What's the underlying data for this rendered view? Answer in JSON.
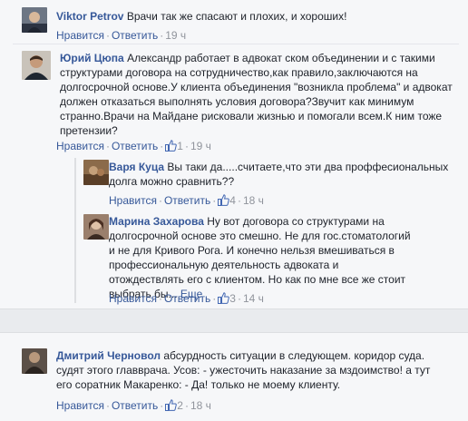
{
  "comments": [
    {
      "author": "Viktor Petrov",
      "text": "Врачи так же спасают и плохих, и хороших!",
      "like": "Нравится",
      "reply": "Ответить",
      "time": "19 ч"
    },
    {
      "author": "Юрий Цюпа",
      "text": "Александр работает в адвокат ском объединении и с такими структурами договора на сотрудничество,как правило,заключаются на долгосрочной основе.У клиента объединения \"возникла проблема\" и адвокат должен отказаться выполнять условия договора?Звучит как минимум странно.Врачи на Майдане рисковали жизнью и помогали всем.К ним тоже претензии?",
      "like": "Нравится",
      "reply": "Ответить",
      "likes": "1",
      "time": "19 ч"
    },
    {
      "author": "Варя Куца",
      "text": "Вы таки да.....считаете,что эти два проффесиональных долга можно сравнить??",
      "like": "Нравится",
      "reply": "Ответить",
      "likes": "4",
      "time": "18 ч"
    },
    {
      "author": "Марина Захарова",
      "text": "Ну вот договора со структурами на долгосрочной основе это смешно. Не для гос.стоматологий и не для Кривого Рога. И конечно нельзя вмешиваться в профессиональную деятельность адвоката и отождествлять его с клиентом. Но как по мне все же стоит выбрать бы...",
      "more": "Еще",
      "like": "Нравится",
      "reply": "Ответить",
      "likes": "3",
      "time": "14 ч"
    },
    {
      "author": "Дмитрий Черновол",
      "text": "абсурдность ситуации в следующем. коридор суда. судят этого главврача. Усов: - ужесточить наказание за мздоимство! а тут его соратник Макаренко: - Да! только не моему клиенту.",
      "like": "Нравится",
      "reply": "Ответить",
      "likes": "2",
      "time": "18 ч"
    }
  ],
  "colors": {
    "link": "#365899",
    "meta": "#90949c",
    "like_blue": "#4267b2"
  }
}
